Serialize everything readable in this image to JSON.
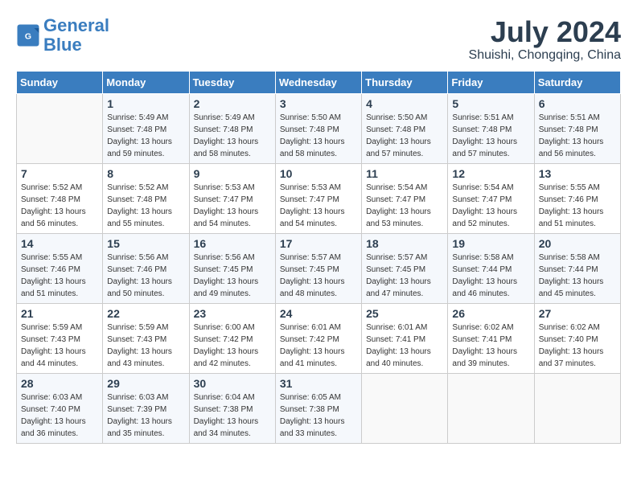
{
  "header": {
    "logo_line1": "General",
    "logo_line2": "Blue",
    "month_year": "July 2024",
    "location": "Shuishi, Chongqing, China"
  },
  "weekdays": [
    "Sunday",
    "Monday",
    "Tuesday",
    "Wednesday",
    "Thursday",
    "Friday",
    "Saturday"
  ],
  "weeks": [
    [
      {
        "day": "",
        "info": ""
      },
      {
        "day": "1",
        "info": "Sunrise: 5:49 AM\nSunset: 7:48 PM\nDaylight: 13 hours\nand 59 minutes."
      },
      {
        "day": "2",
        "info": "Sunrise: 5:49 AM\nSunset: 7:48 PM\nDaylight: 13 hours\nand 58 minutes."
      },
      {
        "day": "3",
        "info": "Sunrise: 5:50 AM\nSunset: 7:48 PM\nDaylight: 13 hours\nand 58 minutes."
      },
      {
        "day": "4",
        "info": "Sunrise: 5:50 AM\nSunset: 7:48 PM\nDaylight: 13 hours\nand 57 minutes."
      },
      {
        "day": "5",
        "info": "Sunrise: 5:51 AM\nSunset: 7:48 PM\nDaylight: 13 hours\nand 57 minutes."
      },
      {
        "day": "6",
        "info": "Sunrise: 5:51 AM\nSunset: 7:48 PM\nDaylight: 13 hours\nand 56 minutes."
      }
    ],
    [
      {
        "day": "7",
        "info": "Sunrise: 5:52 AM\nSunset: 7:48 PM\nDaylight: 13 hours\nand 56 minutes."
      },
      {
        "day": "8",
        "info": "Sunrise: 5:52 AM\nSunset: 7:48 PM\nDaylight: 13 hours\nand 55 minutes."
      },
      {
        "day": "9",
        "info": "Sunrise: 5:53 AM\nSunset: 7:47 PM\nDaylight: 13 hours\nand 54 minutes."
      },
      {
        "day": "10",
        "info": "Sunrise: 5:53 AM\nSunset: 7:47 PM\nDaylight: 13 hours\nand 54 minutes."
      },
      {
        "day": "11",
        "info": "Sunrise: 5:54 AM\nSunset: 7:47 PM\nDaylight: 13 hours\nand 53 minutes."
      },
      {
        "day": "12",
        "info": "Sunrise: 5:54 AM\nSunset: 7:47 PM\nDaylight: 13 hours\nand 52 minutes."
      },
      {
        "day": "13",
        "info": "Sunrise: 5:55 AM\nSunset: 7:46 PM\nDaylight: 13 hours\nand 51 minutes."
      }
    ],
    [
      {
        "day": "14",
        "info": "Sunrise: 5:55 AM\nSunset: 7:46 PM\nDaylight: 13 hours\nand 51 minutes."
      },
      {
        "day": "15",
        "info": "Sunrise: 5:56 AM\nSunset: 7:46 PM\nDaylight: 13 hours\nand 50 minutes."
      },
      {
        "day": "16",
        "info": "Sunrise: 5:56 AM\nSunset: 7:45 PM\nDaylight: 13 hours\nand 49 minutes."
      },
      {
        "day": "17",
        "info": "Sunrise: 5:57 AM\nSunset: 7:45 PM\nDaylight: 13 hours\nand 48 minutes."
      },
      {
        "day": "18",
        "info": "Sunrise: 5:57 AM\nSunset: 7:45 PM\nDaylight: 13 hours\nand 47 minutes."
      },
      {
        "day": "19",
        "info": "Sunrise: 5:58 AM\nSunset: 7:44 PM\nDaylight: 13 hours\nand 46 minutes."
      },
      {
        "day": "20",
        "info": "Sunrise: 5:58 AM\nSunset: 7:44 PM\nDaylight: 13 hours\nand 45 minutes."
      }
    ],
    [
      {
        "day": "21",
        "info": "Sunrise: 5:59 AM\nSunset: 7:43 PM\nDaylight: 13 hours\nand 44 minutes."
      },
      {
        "day": "22",
        "info": "Sunrise: 5:59 AM\nSunset: 7:43 PM\nDaylight: 13 hours\nand 43 minutes."
      },
      {
        "day": "23",
        "info": "Sunrise: 6:00 AM\nSunset: 7:42 PM\nDaylight: 13 hours\nand 42 minutes."
      },
      {
        "day": "24",
        "info": "Sunrise: 6:01 AM\nSunset: 7:42 PM\nDaylight: 13 hours\nand 41 minutes."
      },
      {
        "day": "25",
        "info": "Sunrise: 6:01 AM\nSunset: 7:41 PM\nDaylight: 13 hours\nand 40 minutes."
      },
      {
        "day": "26",
        "info": "Sunrise: 6:02 AM\nSunset: 7:41 PM\nDaylight: 13 hours\nand 39 minutes."
      },
      {
        "day": "27",
        "info": "Sunrise: 6:02 AM\nSunset: 7:40 PM\nDaylight: 13 hours\nand 37 minutes."
      }
    ],
    [
      {
        "day": "28",
        "info": "Sunrise: 6:03 AM\nSunset: 7:40 PM\nDaylight: 13 hours\nand 36 minutes."
      },
      {
        "day": "29",
        "info": "Sunrise: 6:03 AM\nSunset: 7:39 PM\nDaylight: 13 hours\nand 35 minutes."
      },
      {
        "day": "30",
        "info": "Sunrise: 6:04 AM\nSunset: 7:38 PM\nDaylight: 13 hours\nand 34 minutes."
      },
      {
        "day": "31",
        "info": "Sunrise: 6:05 AM\nSunset: 7:38 PM\nDaylight: 13 hours\nand 33 minutes."
      },
      {
        "day": "",
        "info": ""
      },
      {
        "day": "",
        "info": ""
      },
      {
        "day": "",
        "info": ""
      }
    ]
  ]
}
